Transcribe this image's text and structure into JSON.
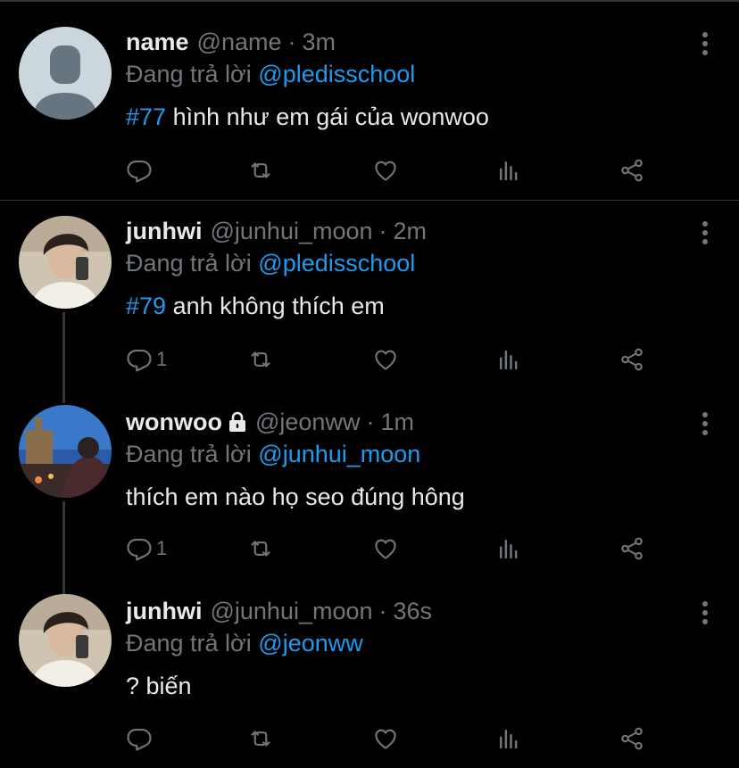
{
  "colors": {
    "background": "#000000",
    "text": "#e7e9ea",
    "muted": "#71767b",
    "accent": "#1d9bf0",
    "divider": "#2f3336"
  },
  "reply_prefix": "Đang trả lời",
  "tweets": [
    {
      "name": "name",
      "handle": "@name",
      "time": "3m",
      "reply_to": "@pledisschool",
      "hashtag": "#77",
      "text": "hình như em gái của wonwoo",
      "reply_count": ""
    },
    {
      "name": "junhwi",
      "handle": "@junhui_moon",
      "time": "2m",
      "reply_to": "@pledisschool",
      "hashtag": "#79",
      "text": "anh không thích em",
      "reply_count": "1"
    },
    {
      "name": "wonwoo",
      "handle": "@jeonww",
      "time": "1m",
      "reply_to": "@junhui_moon",
      "hashtag": "",
      "text": "thích em nào họ seo đúng hông",
      "reply_count": "1",
      "locked": true
    },
    {
      "name": "junhwi",
      "handle": "@junhui_moon",
      "time": "36s",
      "reply_to": "@jeonww",
      "hashtag": "",
      "text": "? biến",
      "reply_count": ""
    }
  ],
  "icons": [
    "reply-icon",
    "retweet-icon",
    "like-icon",
    "views-icon",
    "share-icon",
    "more-icon",
    "lock-icon"
  ]
}
